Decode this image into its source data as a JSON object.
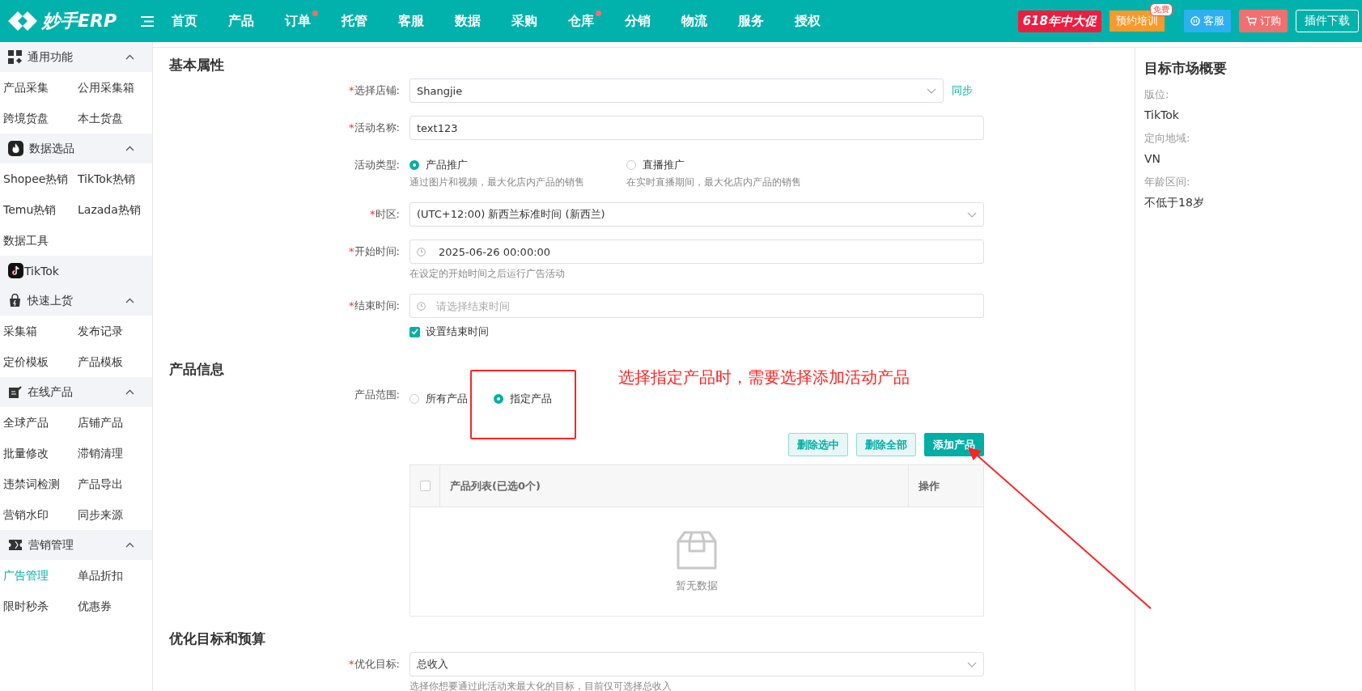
{
  "header": {
    "logo": "妙手ERP",
    "nav": [
      {
        "label": "首页",
        "dot": false
      },
      {
        "label": "产品",
        "dot": false
      },
      {
        "label": "订单",
        "dot": true
      },
      {
        "label": "托管",
        "dot": false
      },
      {
        "label": "客服",
        "dot": false
      },
      {
        "label": "数据",
        "dot": false
      },
      {
        "label": "采购",
        "dot": false
      },
      {
        "label": "仓库",
        "dot": true
      },
      {
        "label": "分销",
        "dot": false
      },
      {
        "label": "物流",
        "dot": false
      },
      {
        "label": "服务",
        "dot": false
      },
      {
        "label": "授权",
        "dot": false
      }
    ],
    "promo": "618年中大促",
    "training": "预约培训",
    "training_badge": "免费",
    "service": "客服",
    "order": "订购",
    "plugin": "插件下载"
  },
  "sidebar": [
    {
      "title": "通用功能",
      "kind": "grid",
      "expanded": true,
      "items": [
        {
          "label": "产品采集",
          "selected": false
        },
        {
          "label": "公用采集箱",
          "selected": false
        },
        {
          "label": "跨境货盘",
          "selected": false
        },
        {
          "label": "本土货盘",
          "selected": false
        }
      ]
    },
    {
      "title": "数据选品",
      "kind": "flame",
      "expanded": true,
      "items": [
        {
          "label": "Shopee热销",
          "selected": false
        },
        {
          "label": "TikTok热销",
          "selected": false
        },
        {
          "label": "Temu热销",
          "selected": false
        },
        {
          "label": "Lazada热销",
          "selected": false
        },
        {
          "label": "数据工具",
          "selected": false
        }
      ]
    },
    {
      "title": "TikTok",
      "kind": "tiktok"
    },
    {
      "title": "快速上货",
      "kind": "bag",
      "expanded": true,
      "items": [
        {
          "label": "采集箱",
          "selected": false
        },
        {
          "label": "发布记录",
          "selected": false
        },
        {
          "label": "定价模板",
          "selected": false
        },
        {
          "label": "产品模板",
          "selected": false
        }
      ]
    },
    {
      "title": "在线产品",
      "kind": "edit",
      "expanded": true,
      "items": [
        {
          "label": "全球产品",
          "selected": false
        },
        {
          "label": "店铺产品",
          "selected": false
        },
        {
          "label": "批量修改",
          "selected": false
        },
        {
          "label": "滞销清理",
          "selected": false
        },
        {
          "label": "违禁词检测",
          "selected": false
        },
        {
          "label": "产品导出",
          "selected": false
        },
        {
          "label": "营销水印",
          "selected": false
        },
        {
          "label": "同步来源",
          "selected": false
        }
      ]
    },
    {
      "title": "营销管理",
      "kind": "ticket",
      "expanded": true,
      "items": [
        {
          "label": "广告管理",
          "selected": true
        },
        {
          "label": "单品折扣",
          "selected": false
        },
        {
          "label": "限时秒杀",
          "selected": false
        },
        {
          "label": "优惠券",
          "selected": false
        }
      ]
    }
  ],
  "basic": {
    "title": "基本属性",
    "store": {
      "label": "选择店铺:",
      "mark": "*",
      "value": "Shangjie",
      "link": "同步"
    },
    "name": {
      "label": "活动名称:",
      "mark": "*",
      "value": "text123"
    },
    "type": {
      "label": "活动类型:",
      "options": [
        {
          "label": "产品推广",
          "help": "通过图片和视频，最大化店内产品的销售",
          "selected": true
        },
        {
          "label": "直播推广",
          "help": "在实时直播期间，最大化店内产品的销售",
          "selected": false
        }
      ]
    },
    "timezone": {
      "label": "时区:",
      "mark": "*",
      "value": "(UTC+12:00) 新西兰标准时间 (新西兰)"
    },
    "start": {
      "label": "开始时间:",
      "mark": "*",
      "value": "2025-06-26 00:00:00",
      "help": "在设定的开始时间之后运行广告活动"
    },
    "end": {
      "label": "结束时间:",
      "mark": "*",
      "placeholder": "请选择结束时间",
      "checkbox": {
        "label": "设置结束时间",
        "checked": true
      }
    }
  },
  "product": {
    "title": "产品信息",
    "scope": {
      "label": "产品范围:",
      "options": [
        {
          "label": "所有产品",
          "selected": false
        },
        {
          "label": "指定产品",
          "selected": true
        }
      ]
    },
    "annotation": "选择指定产品时，需要选择添加活动产品",
    "buttons": [
      {
        "label": "删除选中",
        "kind": "light"
      },
      {
        "label": "删除全部",
        "kind": "light"
      },
      {
        "label": "添加产品",
        "kind": "primary"
      }
    ],
    "table": {
      "select_all": false,
      "columns": [
        "产品列表(已选0个)",
        "操作"
      ],
      "empty": "暂无数据"
    }
  },
  "goal": {
    "title": "优化目标和预算",
    "target": {
      "label": "优化目标:",
      "mark": "*",
      "value": "总收入",
      "help": "选择你想要通过此活动来最大化的目标，目前仅可选择总收入"
    }
  },
  "summary": {
    "title": "目标市场概要",
    "rows": [
      {
        "label": "版位:",
        "value": "TikTok"
      },
      {
        "label": "定向地域:",
        "value": "VN"
      },
      {
        "label": "年龄区间:",
        "value": "不低于18岁"
      }
    ]
  }
}
